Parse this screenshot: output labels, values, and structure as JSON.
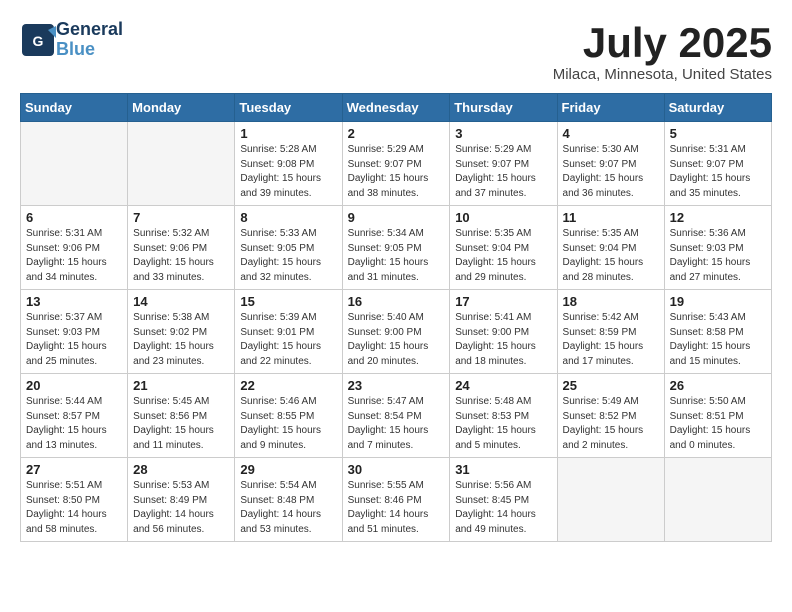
{
  "header": {
    "logo_general": "General",
    "logo_blue": "Blue",
    "month_title": "July 2025",
    "location": "Milaca, Minnesota, United States"
  },
  "weekdays": [
    "Sunday",
    "Monday",
    "Tuesday",
    "Wednesday",
    "Thursday",
    "Friday",
    "Saturday"
  ],
  "weeks": [
    [
      {
        "num": "",
        "detail": ""
      },
      {
        "num": "",
        "detail": ""
      },
      {
        "num": "1",
        "detail": "Sunrise: 5:28 AM\nSunset: 9:08 PM\nDaylight: 15 hours\nand 39 minutes."
      },
      {
        "num": "2",
        "detail": "Sunrise: 5:29 AM\nSunset: 9:07 PM\nDaylight: 15 hours\nand 38 minutes."
      },
      {
        "num": "3",
        "detail": "Sunrise: 5:29 AM\nSunset: 9:07 PM\nDaylight: 15 hours\nand 37 minutes."
      },
      {
        "num": "4",
        "detail": "Sunrise: 5:30 AM\nSunset: 9:07 PM\nDaylight: 15 hours\nand 36 minutes."
      },
      {
        "num": "5",
        "detail": "Sunrise: 5:31 AM\nSunset: 9:07 PM\nDaylight: 15 hours\nand 35 minutes."
      }
    ],
    [
      {
        "num": "6",
        "detail": "Sunrise: 5:31 AM\nSunset: 9:06 PM\nDaylight: 15 hours\nand 34 minutes."
      },
      {
        "num": "7",
        "detail": "Sunrise: 5:32 AM\nSunset: 9:06 PM\nDaylight: 15 hours\nand 33 minutes."
      },
      {
        "num": "8",
        "detail": "Sunrise: 5:33 AM\nSunset: 9:05 PM\nDaylight: 15 hours\nand 32 minutes."
      },
      {
        "num": "9",
        "detail": "Sunrise: 5:34 AM\nSunset: 9:05 PM\nDaylight: 15 hours\nand 31 minutes."
      },
      {
        "num": "10",
        "detail": "Sunrise: 5:35 AM\nSunset: 9:04 PM\nDaylight: 15 hours\nand 29 minutes."
      },
      {
        "num": "11",
        "detail": "Sunrise: 5:35 AM\nSunset: 9:04 PM\nDaylight: 15 hours\nand 28 minutes."
      },
      {
        "num": "12",
        "detail": "Sunrise: 5:36 AM\nSunset: 9:03 PM\nDaylight: 15 hours\nand 27 minutes."
      }
    ],
    [
      {
        "num": "13",
        "detail": "Sunrise: 5:37 AM\nSunset: 9:03 PM\nDaylight: 15 hours\nand 25 minutes."
      },
      {
        "num": "14",
        "detail": "Sunrise: 5:38 AM\nSunset: 9:02 PM\nDaylight: 15 hours\nand 23 minutes."
      },
      {
        "num": "15",
        "detail": "Sunrise: 5:39 AM\nSunset: 9:01 PM\nDaylight: 15 hours\nand 22 minutes."
      },
      {
        "num": "16",
        "detail": "Sunrise: 5:40 AM\nSunset: 9:00 PM\nDaylight: 15 hours\nand 20 minutes."
      },
      {
        "num": "17",
        "detail": "Sunrise: 5:41 AM\nSunset: 9:00 PM\nDaylight: 15 hours\nand 18 minutes."
      },
      {
        "num": "18",
        "detail": "Sunrise: 5:42 AM\nSunset: 8:59 PM\nDaylight: 15 hours\nand 17 minutes."
      },
      {
        "num": "19",
        "detail": "Sunrise: 5:43 AM\nSunset: 8:58 PM\nDaylight: 15 hours\nand 15 minutes."
      }
    ],
    [
      {
        "num": "20",
        "detail": "Sunrise: 5:44 AM\nSunset: 8:57 PM\nDaylight: 15 hours\nand 13 minutes."
      },
      {
        "num": "21",
        "detail": "Sunrise: 5:45 AM\nSunset: 8:56 PM\nDaylight: 15 hours\nand 11 minutes."
      },
      {
        "num": "22",
        "detail": "Sunrise: 5:46 AM\nSunset: 8:55 PM\nDaylight: 15 hours\nand 9 minutes."
      },
      {
        "num": "23",
        "detail": "Sunrise: 5:47 AM\nSunset: 8:54 PM\nDaylight: 15 hours\nand 7 minutes."
      },
      {
        "num": "24",
        "detail": "Sunrise: 5:48 AM\nSunset: 8:53 PM\nDaylight: 15 hours\nand 5 minutes."
      },
      {
        "num": "25",
        "detail": "Sunrise: 5:49 AM\nSunset: 8:52 PM\nDaylight: 15 hours\nand 2 minutes."
      },
      {
        "num": "26",
        "detail": "Sunrise: 5:50 AM\nSunset: 8:51 PM\nDaylight: 15 hours\nand 0 minutes."
      }
    ],
    [
      {
        "num": "27",
        "detail": "Sunrise: 5:51 AM\nSunset: 8:50 PM\nDaylight: 14 hours\nand 58 minutes."
      },
      {
        "num": "28",
        "detail": "Sunrise: 5:53 AM\nSunset: 8:49 PM\nDaylight: 14 hours\nand 56 minutes."
      },
      {
        "num": "29",
        "detail": "Sunrise: 5:54 AM\nSunset: 8:48 PM\nDaylight: 14 hours\nand 53 minutes."
      },
      {
        "num": "30",
        "detail": "Sunrise: 5:55 AM\nSunset: 8:46 PM\nDaylight: 14 hours\nand 51 minutes."
      },
      {
        "num": "31",
        "detail": "Sunrise: 5:56 AM\nSunset: 8:45 PM\nDaylight: 14 hours\nand 49 minutes."
      },
      {
        "num": "",
        "detail": ""
      },
      {
        "num": "",
        "detail": ""
      }
    ]
  ]
}
